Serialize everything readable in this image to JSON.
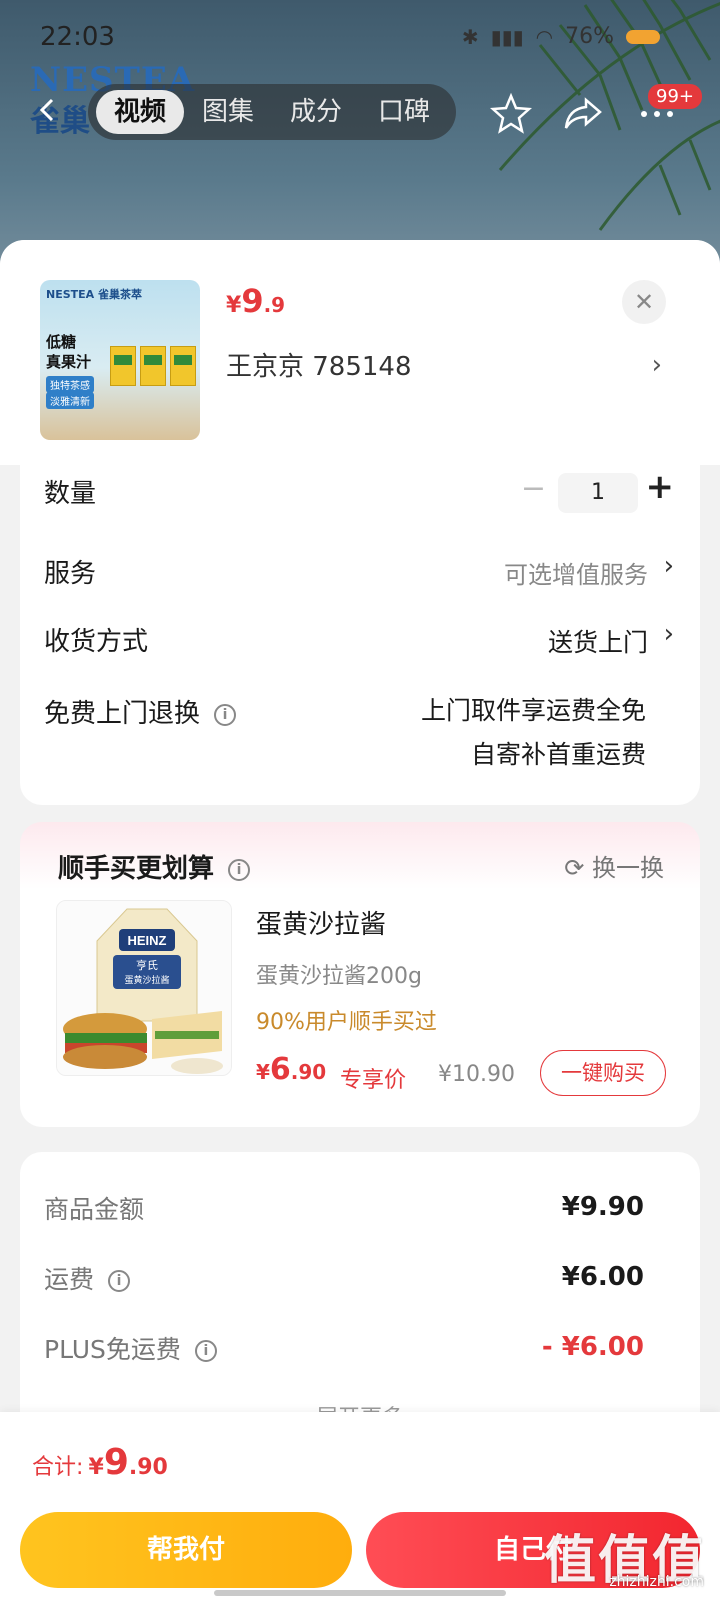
{
  "status_bar": {
    "time": "22:03",
    "battery": "76%"
  },
  "brand": {
    "logo_en": "NESTEA",
    "logo_cn": "雀巢"
  },
  "tabs": [
    {
      "label": "视频",
      "active": true
    },
    {
      "label": "图集",
      "active": false
    },
    {
      "label": "成分",
      "active": false
    },
    {
      "label": "口碑",
      "active": false
    }
  ],
  "nav": {
    "message_badge": "99+"
  },
  "product": {
    "price_currency": "¥",
    "price_int": "9",
    "price_dec": ".9",
    "seller": "王京京 785148",
    "thumb": {
      "logo": "NESTEA 雀巢茶萃",
      "headline_1": "低糖",
      "headline_2": "真果汁",
      "tag_1": "独特茶感",
      "tag_2": "淡雅清新"
    }
  },
  "options": {
    "quantity_label": "数量",
    "quantity_value": "1",
    "service_label": "服务",
    "service_value": "可选增值服务",
    "delivery_label": "收货方式",
    "delivery_value": "送货上门",
    "return_label": "免费上门退换",
    "return_line1": "上门取件享运费全免",
    "return_line2": "自寄补首重运费"
  },
  "combo": {
    "title": "顺手买更划算",
    "swap_label": "换一换",
    "item_name": "蛋黄沙拉酱",
    "item_spec": "蛋黄沙拉酱200g",
    "bought_text": "90%用户顺手买过",
    "price_currency": "¥",
    "price_int": "6",
    "price_dec": ".90",
    "exclusive_label": "专享价",
    "original_price": "¥10.90",
    "buy_button": "一键购买",
    "image_brand": "HEINZ",
    "image_label_1": "亨氏",
    "image_label_2": "蛋黄沙拉酱"
  },
  "summary": {
    "goods_label": "商品金额",
    "goods_value": "¥9.90",
    "shipping_label": "运费",
    "shipping_value": "¥6.00",
    "plus_label": "PLUS免运费",
    "plus_value": "- ¥6.00",
    "expand_label": "展开更多"
  },
  "footer": {
    "total_label": "合计:",
    "total_currency": "¥",
    "total_int": "9",
    "total_dec": ".90",
    "help_pay_button": "帮我付",
    "self_pay_button": "自己付"
  },
  "watermark": {
    "text": "值值值",
    "url": "zhizhizhi.com"
  },
  "colors": {
    "accent_red": "#e4393c",
    "accent_yellow": "#ffb715",
    "combo_gold": "#c98a2b"
  }
}
